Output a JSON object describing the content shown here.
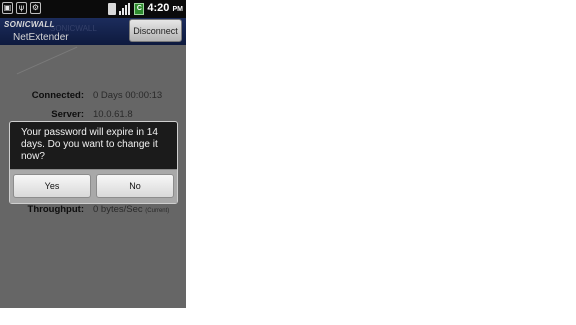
{
  "status_bar": {
    "time": "4:20",
    "ampm": "PM",
    "battery_level": "C"
  },
  "app_bar": {
    "brand": "SONICWALL",
    "brand_faint": "SONICWALL",
    "app_name": "NetExtender",
    "disconnect_label": "Disconnect"
  },
  "connection": [
    {
      "label": "Connected:",
      "value": "0 Days 00:00:13"
    },
    {
      "label": "Server:",
      "value": "10.0.61.8"
    },
    {
      "label": "Throughput:",
      "value": "0 bytes/Sec",
      "note": "(Current)"
    }
  ],
  "dialog": {
    "message": "Your password will expire in 14 days. Do you want to change it now?",
    "yes_label": "Yes",
    "no_label": "No"
  }
}
